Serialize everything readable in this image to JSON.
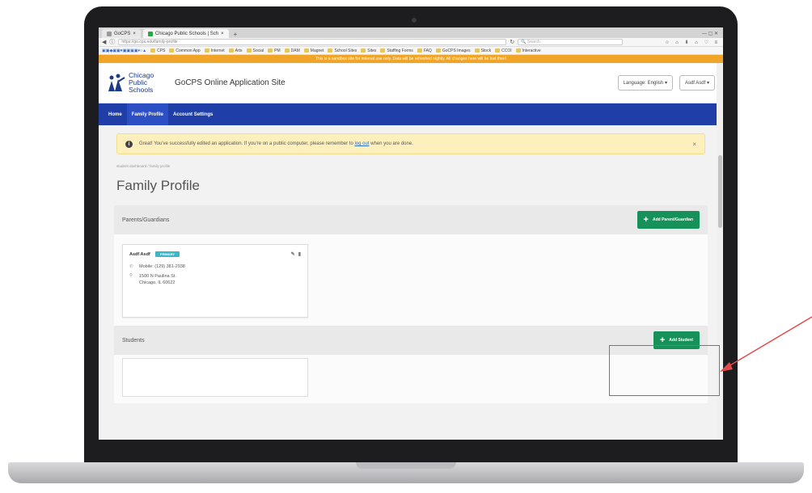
{
  "browser": {
    "tabs": [
      {
        "label": "GoCPS",
        "active": false
      },
      {
        "label": "Chicago Public Schools | Sch",
        "active": true
      }
    ],
    "url": "https://go.cps.edu/family-profile",
    "search_placeholder": "Search",
    "bookmarks": [
      "CPS",
      "Common App",
      "Internet",
      "Arts",
      "Social",
      "PM",
      "DAM",
      "Magnet",
      "School Sites",
      "Sites",
      "Staffing Forms",
      "FAQ",
      "GoCPS Images",
      "Stock",
      "CCOI",
      "Interactive"
    ],
    "sandbox_banner": "This is a sandbox site for internal use only. Data will be refreshed nightly. All changes here will be lost then!"
  },
  "site": {
    "logo_lines": [
      "Chicago",
      "Public",
      "Schools"
    ],
    "title": "GoCPS Online Application Site",
    "language_button": "Language: English",
    "user_button": "Asdf Asdf"
  },
  "nav": {
    "home": "Home",
    "family_profile": "Family Profile",
    "account_settings": "Account Settings"
  },
  "alert": {
    "text_before": "Great! You've successfully edited an application. If you're on a public computer, please remember to",
    "link": "log out",
    "text_after": "when you are done.",
    "close": "×"
  },
  "breadcrumb": "student dashboard  /  family profile",
  "page_title": "Family Profile",
  "parents": {
    "heading": "Parents/Guardians",
    "add_button": "Add Parent/Guardian",
    "card": {
      "name": "Asdf Asdf",
      "badge": "PRIMARY",
      "phone": "Mobile: (129) 381-2938",
      "address_line1": "1500 N Paulina St.",
      "address_line2": "Chicago, IL 60622"
    }
  },
  "students": {
    "heading": "Students",
    "add_button": "Add Student"
  },
  "colors": {
    "nav_blue": "#1f3ea8",
    "sandbox_orange": "#f0a428",
    "button_green": "#16915a",
    "annotation_red": "#e24a4a"
  }
}
